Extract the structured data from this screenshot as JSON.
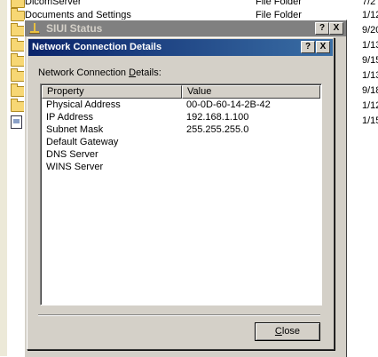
{
  "explorer": {
    "rows": [
      {
        "name": "DicomServer",
        "type": "File Folder",
        "date": "7/2"
      },
      {
        "name": "Documents and Settings",
        "type": "File Folder",
        "date": "1/12"
      },
      {
        "name": "",
        "type": "",
        "date": "9/20"
      },
      {
        "name": "",
        "type": "",
        "date": "1/13"
      },
      {
        "name": "",
        "type": "",
        "date": "9/15"
      },
      {
        "name": "",
        "type": "",
        "date": "1/13"
      },
      {
        "name": "",
        "type": "",
        "date": "9/18"
      },
      {
        "name": "",
        "type": "",
        "date": "1/12"
      },
      {
        "name": "",
        "type": "",
        "date": "1/15"
      }
    ]
  },
  "status_window": {
    "title": "SIUI Status",
    "help_label": "?",
    "close_label": "X"
  },
  "details_dialog": {
    "title": "Network Connection Details",
    "help_label": "?",
    "close_label": "X",
    "caption_prefix": "Network Connection ",
    "caption_mnemonic": "D",
    "caption_suffix": "etails:",
    "columns": {
      "property": "Property",
      "value": "Value"
    },
    "rows": [
      {
        "property": "Physical Address",
        "value": "00-0D-60-14-2B-42"
      },
      {
        "property": "IP Address",
        "value": "192.168.1.100"
      },
      {
        "property": "Subnet Mask",
        "value": "255.255.255.0"
      },
      {
        "property": "Default Gateway",
        "value": ""
      },
      {
        "property": "DNS Server",
        "value": ""
      },
      {
        "property": "WINS Server",
        "value": ""
      }
    ],
    "close_button": {
      "mnemonic": "C",
      "rest": "lose"
    }
  }
}
